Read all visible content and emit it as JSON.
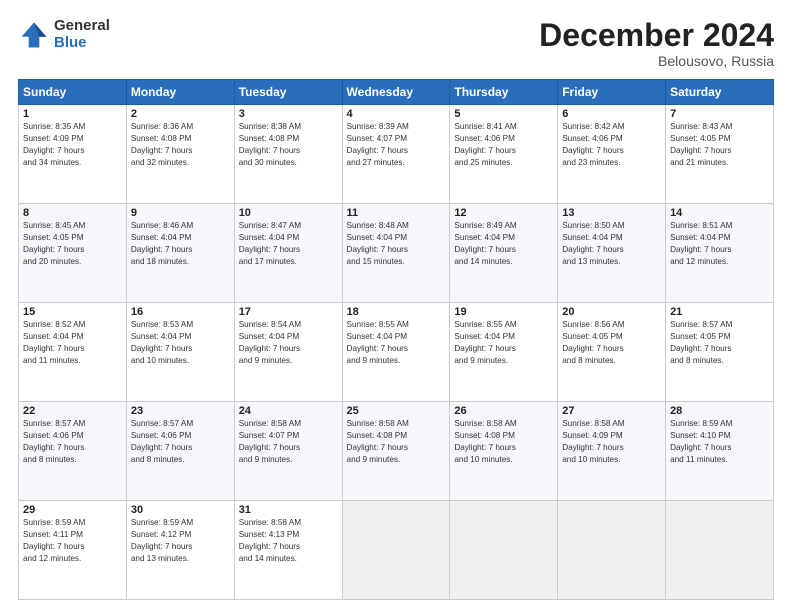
{
  "logo": {
    "general": "General",
    "blue": "Blue"
  },
  "header": {
    "title": "December 2024",
    "subtitle": "Belousovo, Russia"
  },
  "weekdays": [
    "Sunday",
    "Monday",
    "Tuesday",
    "Wednesday",
    "Thursday",
    "Friday",
    "Saturday"
  ],
  "weeks": [
    [
      {
        "day": "1",
        "sunrise": "Sunrise: 8:35 AM",
        "sunset": "Sunset: 4:09 PM",
        "daylight": "Daylight: 7 hours and 34 minutes."
      },
      {
        "day": "2",
        "sunrise": "Sunrise: 8:36 AM",
        "sunset": "Sunset: 4:08 PM",
        "daylight": "Daylight: 7 hours and 32 minutes."
      },
      {
        "day": "3",
        "sunrise": "Sunrise: 8:38 AM",
        "sunset": "Sunset: 4:08 PM",
        "daylight": "Daylight: 7 hours and 30 minutes."
      },
      {
        "day": "4",
        "sunrise": "Sunrise: 8:39 AM",
        "sunset": "Sunset: 4:07 PM",
        "daylight": "Daylight: 7 hours and 27 minutes."
      },
      {
        "day": "5",
        "sunrise": "Sunrise: 8:41 AM",
        "sunset": "Sunset: 4:06 PM",
        "daylight": "Daylight: 7 hours and 25 minutes."
      },
      {
        "day": "6",
        "sunrise": "Sunrise: 8:42 AM",
        "sunset": "Sunset: 4:06 PM",
        "daylight": "Daylight: 7 hours and 23 minutes."
      },
      {
        "day": "7",
        "sunrise": "Sunrise: 8:43 AM",
        "sunset": "Sunset: 4:05 PM",
        "daylight": "Daylight: 7 hours and 21 minutes."
      }
    ],
    [
      {
        "day": "8",
        "sunrise": "Sunrise: 8:45 AM",
        "sunset": "Sunset: 4:05 PM",
        "daylight": "Daylight: 7 hours and 20 minutes."
      },
      {
        "day": "9",
        "sunrise": "Sunrise: 8:46 AM",
        "sunset": "Sunset: 4:04 PM",
        "daylight": "Daylight: 7 hours and 18 minutes."
      },
      {
        "day": "10",
        "sunrise": "Sunrise: 8:47 AM",
        "sunset": "Sunset: 4:04 PM",
        "daylight": "Daylight: 7 hours and 17 minutes."
      },
      {
        "day": "11",
        "sunrise": "Sunrise: 8:48 AM",
        "sunset": "Sunset: 4:04 PM",
        "daylight": "Daylight: 7 hours and 15 minutes."
      },
      {
        "day": "12",
        "sunrise": "Sunrise: 8:49 AM",
        "sunset": "Sunset: 4:04 PM",
        "daylight": "Daylight: 7 hours and 14 minutes."
      },
      {
        "day": "13",
        "sunrise": "Sunrise: 8:50 AM",
        "sunset": "Sunset: 4:04 PM",
        "daylight": "Daylight: 7 hours and 13 minutes."
      },
      {
        "day": "14",
        "sunrise": "Sunrise: 8:51 AM",
        "sunset": "Sunset: 4:04 PM",
        "daylight": "Daylight: 7 hours and 12 minutes."
      }
    ],
    [
      {
        "day": "15",
        "sunrise": "Sunrise: 8:52 AM",
        "sunset": "Sunset: 4:04 PM",
        "daylight": "Daylight: 7 hours and 11 minutes."
      },
      {
        "day": "16",
        "sunrise": "Sunrise: 8:53 AM",
        "sunset": "Sunset: 4:04 PM",
        "daylight": "Daylight: 7 hours and 10 minutes."
      },
      {
        "day": "17",
        "sunrise": "Sunrise: 8:54 AM",
        "sunset": "Sunset: 4:04 PM",
        "daylight": "Daylight: 7 hours and 9 minutes."
      },
      {
        "day": "18",
        "sunrise": "Sunrise: 8:55 AM",
        "sunset": "Sunset: 4:04 PM",
        "daylight": "Daylight: 7 hours and 9 minutes."
      },
      {
        "day": "19",
        "sunrise": "Sunrise: 8:55 AM",
        "sunset": "Sunset: 4:04 PM",
        "daylight": "Daylight: 7 hours and 9 minutes."
      },
      {
        "day": "20",
        "sunrise": "Sunrise: 8:56 AM",
        "sunset": "Sunset: 4:05 PM",
        "daylight": "Daylight: 7 hours and 8 minutes."
      },
      {
        "day": "21",
        "sunrise": "Sunrise: 8:57 AM",
        "sunset": "Sunset: 4:05 PM",
        "daylight": "Daylight: 7 hours and 8 minutes."
      }
    ],
    [
      {
        "day": "22",
        "sunrise": "Sunrise: 8:57 AM",
        "sunset": "Sunset: 4:06 PM",
        "daylight": "Daylight: 7 hours and 8 minutes."
      },
      {
        "day": "23",
        "sunrise": "Sunrise: 8:57 AM",
        "sunset": "Sunset: 4:06 PM",
        "daylight": "Daylight: 7 hours and 8 minutes."
      },
      {
        "day": "24",
        "sunrise": "Sunrise: 8:58 AM",
        "sunset": "Sunset: 4:07 PM",
        "daylight": "Daylight: 7 hours and 9 minutes."
      },
      {
        "day": "25",
        "sunrise": "Sunrise: 8:58 AM",
        "sunset": "Sunset: 4:08 PM",
        "daylight": "Daylight: 7 hours and 9 minutes."
      },
      {
        "day": "26",
        "sunrise": "Sunrise: 8:58 AM",
        "sunset": "Sunset: 4:08 PM",
        "daylight": "Daylight: 7 hours and 10 minutes."
      },
      {
        "day": "27",
        "sunrise": "Sunrise: 8:58 AM",
        "sunset": "Sunset: 4:09 PM",
        "daylight": "Daylight: 7 hours and 10 minutes."
      },
      {
        "day": "28",
        "sunrise": "Sunrise: 8:59 AM",
        "sunset": "Sunset: 4:10 PM",
        "daylight": "Daylight: 7 hours and 11 minutes."
      }
    ],
    [
      {
        "day": "29",
        "sunrise": "Sunrise: 8:59 AM",
        "sunset": "Sunset: 4:11 PM",
        "daylight": "Daylight: 7 hours and 12 minutes."
      },
      {
        "day": "30",
        "sunrise": "Sunrise: 8:59 AM",
        "sunset": "Sunset: 4:12 PM",
        "daylight": "Daylight: 7 hours and 13 minutes."
      },
      {
        "day": "31",
        "sunrise": "Sunrise: 8:58 AM",
        "sunset": "Sunset: 4:13 PM",
        "daylight": "Daylight: 7 hours and 14 minutes."
      },
      null,
      null,
      null,
      null
    ]
  ]
}
